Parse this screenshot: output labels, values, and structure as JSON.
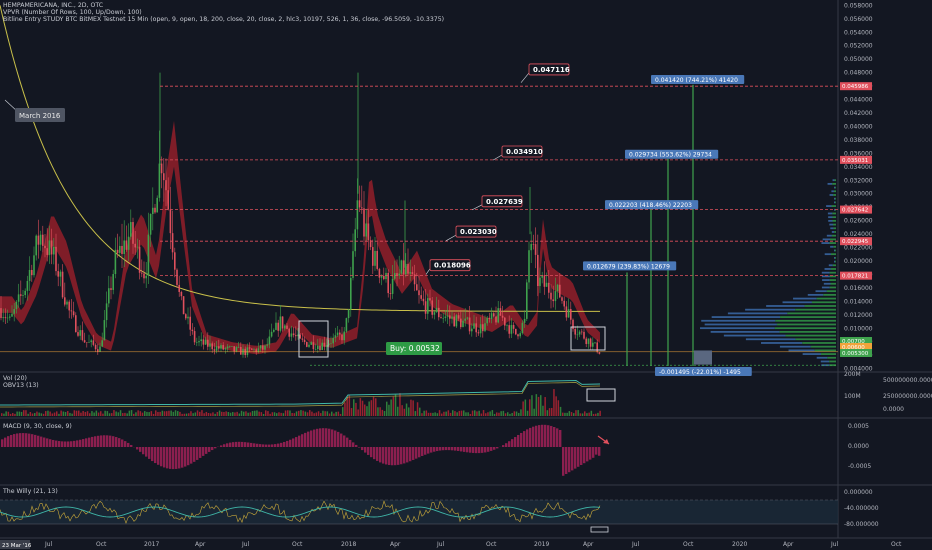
{
  "header": {
    "line1": "HEMPAMERICANA, INC., 2D, OTC",
    "line2": "VPVR (Number Of Rows, 100, Up/Down, 100)",
    "line3": "Bitline Entry STUDY BTC BitMEX Testnet 15 Min (open, 9, open, 18, 200, close, 20, close, 2, hlc3, 10197, 526, 1, 36, close, -96.5059, -10.3375)"
  },
  "panes": {
    "volume": {
      "title1": "Vol (20)",
      "title2": "OBV13 (13)"
    },
    "macd": {
      "title": "MACD (9, 30, close, 9)"
    },
    "willy": {
      "title": "The Willy (21, 13)"
    }
  },
  "chart_data": {
    "type": "candlestick",
    "symbol": "HEMPAMERICANA, INC.",
    "interval": "2D",
    "price_axis": [
      "0.058000",
      "0.056000",
      "0.054000",
      "0.052000",
      "0.050000",
      "0.048000",
      "0.046000",
      "0.044000",
      "0.042000",
      "0.040000",
      "0.038000",
      "0.036000",
      "0.034000",
      "0.032000",
      "0.030000",
      "0.028000",
      "0.026000",
      "0.024000",
      "0.022000",
      "0.020000",
      "0.018000",
      "0.016000",
      "0.014000",
      "0.012000",
      "0.010000",
      "0.008000",
      "0.006000",
      "0.004000"
    ],
    "y_range": [
      0.0035,
      0.0585
    ],
    "x_axis": [
      "Jul",
      "Oct",
      "2017",
      "Apr",
      "Jul",
      "Oct",
      "2018",
      "Apr",
      "Jul",
      "Oct",
      "2019",
      "Apr",
      "Jul",
      "Oct",
      "2020",
      "Apr",
      "Jul",
      "Oct"
    ],
    "x_start_tag": "23 Mar '16",
    "annotations": {
      "note": "March 2016",
      "buy_label": "Buy: 0.00532",
      "targets": [
        "0.018096",
        "0.023030",
        "0.027639",
        "0.034910",
        "0.047116"
      ],
      "measures": [
        "0.012679 (239.83%) 12679",
        "0.022203 (418.46%) 22203",
        "0.029734 (553.62%) 29734",
        "0.041420 (744.21%) 41420",
        "-0.001495 (-22.01%) -1495"
      ]
    },
    "price_tags": [
      {
        "value": "0.045986",
        "color": "#e0505d"
      },
      {
        "value": "0.035031",
        "color": "#e0505d"
      },
      {
        "value": "0.027642",
        "color": "#e0505d"
      },
      {
        "value": "0.022945",
        "color": "#e0505d"
      },
      {
        "value": "0.017821",
        "color": "#e0505d"
      },
      {
        "value": "0.00700",
        "color": "#3fa34d"
      },
      {
        "value": "0.00600",
        "color": "#f0a43a"
      },
      {
        "value": "0.005300",
        "color": "#3fa34d"
      }
    ],
    "volume_axis": {
      "left": [
        "200M",
        "100M"
      ],
      "right": [
        "500000000.0000",
        "250000000.0000",
        "0.0000"
      ]
    },
    "macd_axis": [
      "0.0005",
      "0.0000",
      "-0.0005"
    ],
    "willy_axis": [
      "0.000000",
      "-40.000000",
      "-80.000000"
    ],
    "colors": {
      "up": "#3fa34d",
      "down": "#e0505d",
      "ma": "#c9c04a",
      "band": "#9b1f2a",
      "obv": "#3fb6a8",
      "macd": "#8c1f4f",
      "willy": "#3fb6a8",
      "willy_sig": "#c9a93a"
    }
  }
}
